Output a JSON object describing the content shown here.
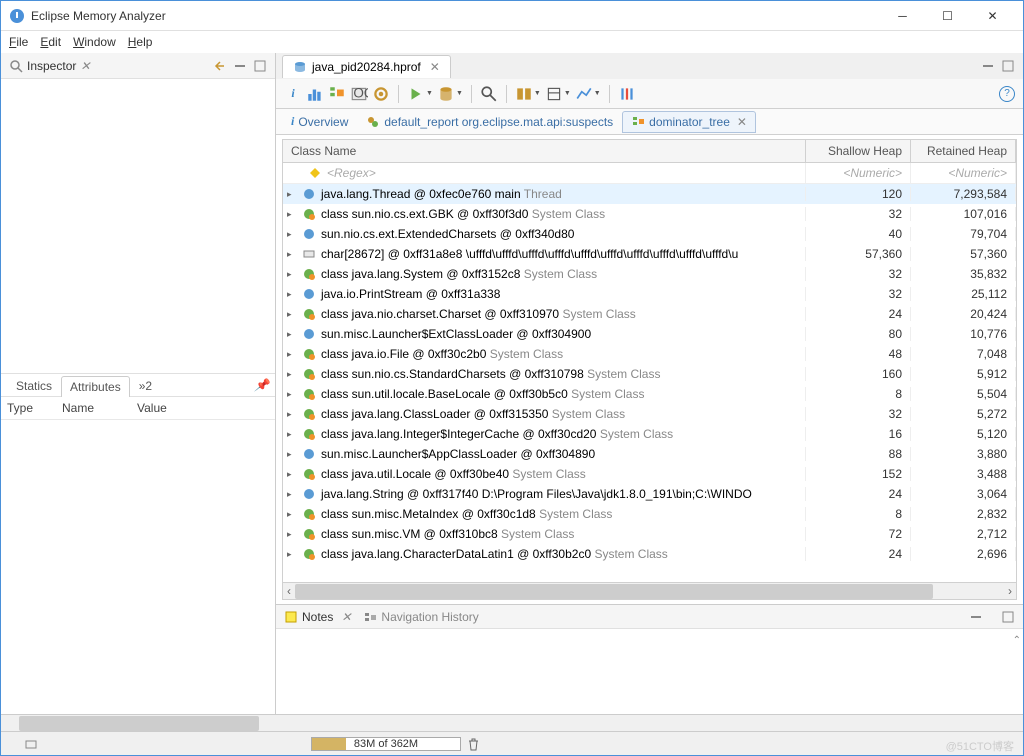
{
  "window": {
    "title": "Eclipse Memory Analyzer"
  },
  "menus": {
    "file": "File",
    "edit": "Edit",
    "window": "Window",
    "help": "Help"
  },
  "inspector": {
    "title": "Inspector",
    "tabs": {
      "statics": "Statics",
      "attributes": "Attributes",
      "more": "»2"
    },
    "columns": {
      "type": "Type",
      "name": "Name",
      "value": "Value"
    }
  },
  "editor": {
    "tab": "java_pid20284.hprof"
  },
  "subtabs": {
    "overview": "Overview",
    "default_report": "default_report  org.eclipse.mat.api:suspects",
    "dominator": "dominator_tree"
  },
  "tree": {
    "headers": {
      "class": "Class Name",
      "shallow": "Shallow Heap",
      "retained": "Retained Heap"
    },
    "regex": {
      "label": "<Regex>",
      "num": "<Numeric>"
    },
    "rows": [
      {
        "text": "java.lang.Thread @ 0xfec0e760  main",
        "suffix": "Thread",
        "shallow": "120",
        "retained": "7,293,584",
        "sel": true,
        "ico": "obj"
      },
      {
        "text": "class sun.nio.cs.ext.GBK @ 0xff30f3d0",
        "suffix": "System Class",
        "shallow": "32",
        "retained": "107,016",
        "ico": "cls"
      },
      {
        "text": "sun.nio.cs.ext.ExtendedCharsets @ 0xff340d80",
        "suffix": "",
        "shallow": "40",
        "retained": "79,704",
        "ico": "obj"
      },
      {
        "text": "char[28672] @ 0xff31a8e8  \\ufffd\\ufffd\\ufffd\\ufffd\\ufffd\\ufffd\\ufffd\\ufffd\\ufffd\\ufffd\\u",
        "suffix": "",
        "shallow": "57,360",
        "retained": "57,360",
        "ico": "arr"
      },
      {
        "text": "class java.lang.System @ 0xff3152c8",
        "suffix": "System Class",
        "shallow": "32",
        "retained": "35,832",
        "ico": "cls"
      },
      {
        "text": "java.io.PrintStream @ 0xff31a338",
        "suffix": "",
        "shallow": "32",
        "retained": "25,112",
        "ico": "obj"
      },
      {
        "text": "class java.nio.charset.Charset @ 0xff310970",
        "suffix": "System Class",
        "shallow": "24",
        "retained": "20,424",
        "ico": "cls"
      },
      {
        "text": "sun.misc.Launcher$ExtClassLoader @ 0xff304900",
        "suffix": "",
        "shallow": "80",
        "retained": "10,776",
        "ico": "obj"
      },
      {
        "text": "class java.io.File @ 0xff30c2b0",
        "suffix": "System Class",
        "shallow": "48",
        "retained": "7,048",
        "ico": "cls"
      },
      {
        "text": "class sun.nio.cs.StandardCharsets @ 0xff310798",
        "suffix": "System Class",
        "shallow": "160",
        "retained": "5,912",
        "ico": "cls"
      },
      {
        "text": "class sun.util.locale.BaseLocale @ 0xff30b5c0",
        "suffix": "System Class",
        "shallow": "8",
        "retained": "5,504",
        "ico": "cls"
      },
      {
        "text": "class java.lang.ClassLoader @ 0xff315350",
        "suffix": "System Class",
        "shallow": "32",
        "retained": "5,272",
        "ico": "cls"
      },
      {
        "text": "class java.lang.Integer$IntegerCache @ 0xff30cd20",
        "suffix": "System Class",
        "shallow": "16",
        "retained": "5,120",
        "ico": "cls"
      },
      {
        "text": "sun.misc.Launcher$AppClassLoader @ 0xff304890",
        "suffix": "",
        "shallow": "88",
        "retained": "3,880",
        "ico": "obj"
      },
      {
        "text": "class java.util.Locale @ 0xff30be40",
        "suffix": "System Class",
        "shallow": "152",
        "retained": "3,488",
        "ico": "cls"
      },
      {
        "text": "java.lang.String @ 0xff317f40  D:\\Program Files\\Java\\jdk1.8.0_191\\bin;C:\\WINDO",
        "suffix": "",
        "shallow": "24",
        "retained": "3,064",
        "ico": "obj"
      },
      {
        "text": "class sun.misc.MetaIndex @ 0xff30c1d8",
        "suffix": "System Class",
        "shallow": "8",
        "retained": "2,832",
        "ico": "cls"
      },
      {
        "text": "class sun.misc.VM @ 0xff310bc8",
        "suffix": "System Class",
        "shallow": "72",
        "retained": "2,712",
        "ico": "cls"
      },
      {
        "text": "class java.lang.CharacterDataLatin1 @ 0xff30b2c0",
        "suffix": "System Class",
        "shallow": "24",
        "retained": "2,696",
        "ico": "cls"
      }
    ]
  },
  "bottom": {
    "notes": "Notes",
    "nav": "Navigation History"
  },
  "status": {
    "heap": "83M of 362M"
  },
  "watermark": "@51CTO博客"
}
